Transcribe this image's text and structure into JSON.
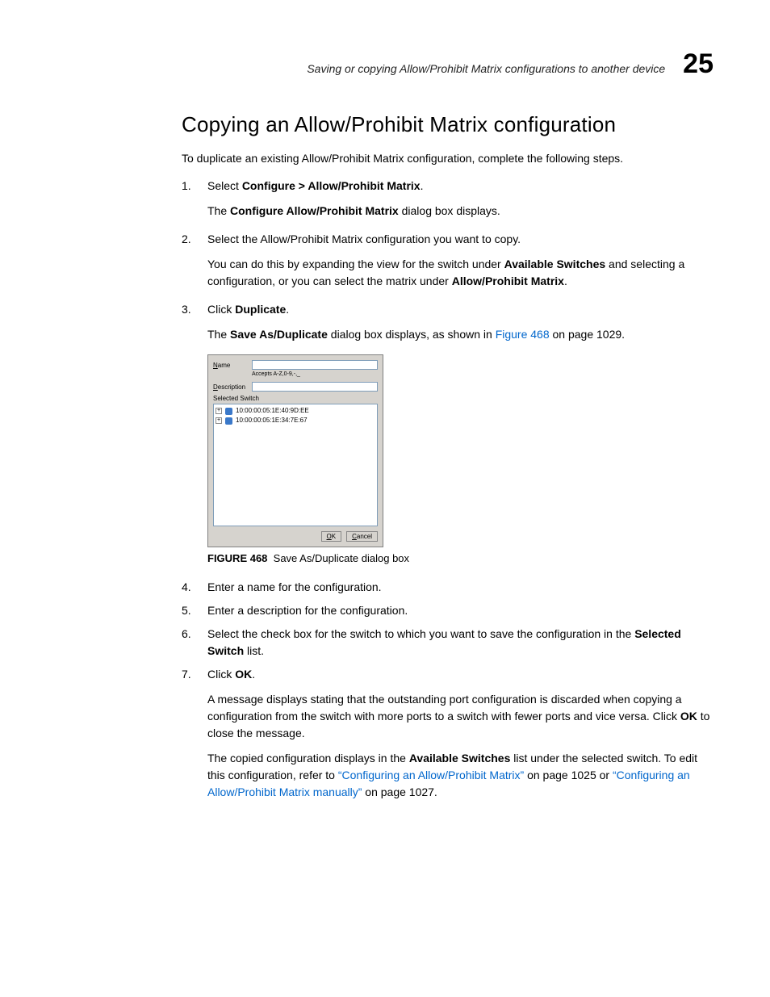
{
  "header": {
    "running_title": "Saving or copying Allow/Prohibit Matrix configurations to another device",
    "chapter_number": "25"
  },
  "title": "Copying an Allow/Prohibit Matrix configuration",
  "intro": "To duplicate an existing Allow/Prohibit Matrix configuration, complete the following steps.",
  "steps": {
    "s1": {
      "num": "1.",
      "pre": "Select ",
      "bold": "Configure > Allow/Prohibit Matrix",
      "post": ".",
      "sub_pre": "The ",
      "sub_bold": "Configure Allow/Prohibit Matrix",
      "sub_post": " dialog box displays."
    },
    "s2": {
      "num": "2.",
      "text": "Select the Allow/Prohibit Matrix configuration you want to copy.",
      "sub_pre": "You can do this by expanding the view for the switch under ",
      "sub_bold1": "Available Switches",
      "sub_mid": " and selecting a configuration, or you can select the matrix under ",
      "sub_bold2": "Allow/Prohibit Matrix",
      "sub_post": "."
    },
    "s3": {
      "num": "3.",
      "pre": "Click ",
      "bold": "Duplicate",
      "post": ".",
      "sub_pre": "The ",
      "sub_bold": "Save As/Duplicate",
      "sub_mid": " dialog box displays, as shown in ",
      "sub_link": "Figure 468",
      "sub_post": " on page 1029."
    },
    "s4": {
      "num": "4.",
      "text": "Enter a name for the configuration."
    },
    "s5": {
      "num": "5.",
      "text": "Enter a description for the configuration."
    },
    "s6": {
      "num": "6.",
      "pre": "Select the check box for the switch to which you want to save the configuration in the ",
      "bold": "Selected Switch",
      "post": " list."
    },
    "s7": {
      "num": "7.",
      "pre": "Click ",
      "bold": "OK",
      "post": ".",
      "p1_pre": "A message displays stating that the outstanding port configuration is discarded when copying a configuration from the switch with more ports to a switch with fewer ports and vice versa. Click ",
      "p1_bold": "OK",
      "p1_post": " to close the message.",
      "p2_pre": "The copied configuration displays in the ",
      "p2_bold": "Available Switches",
      "p2_mid": " list under the selected switch. To edit this configuration, refer to ",
      "p2_link1": "“Configuring an Allow/Prohibit Matrix”",
      "p2_mid2": " on page 1025 or ",
      "p2_link2": "“Configuring an Allow/Prohibit Matrix manually”",
      "p2_post": " on page 1027."
    }
  },
  "dialog": {
    "name_label_u": "N",
    "name_label_rest": "ame",
    "hint": "Accepts A-Z,0-9,-,_",
    "desc_label_u": "D",
    "desc_label_rest": "escription",
    "section": "Selected Switch",
    "rows": [
      "10:00:00:05:1E:40:9D:EE",
      "10:00:00:05:1E:34:7E:67"
    ],
    "ok_u": "O",
    "ok_rest": "K",
    "cancel_u": "C",
    "cancel_rest": "ancel"
  },
  "figure": {
    "label": "FIGURE 468",
    "caption": "Save As/Duplicate dialog box"
  }
}
